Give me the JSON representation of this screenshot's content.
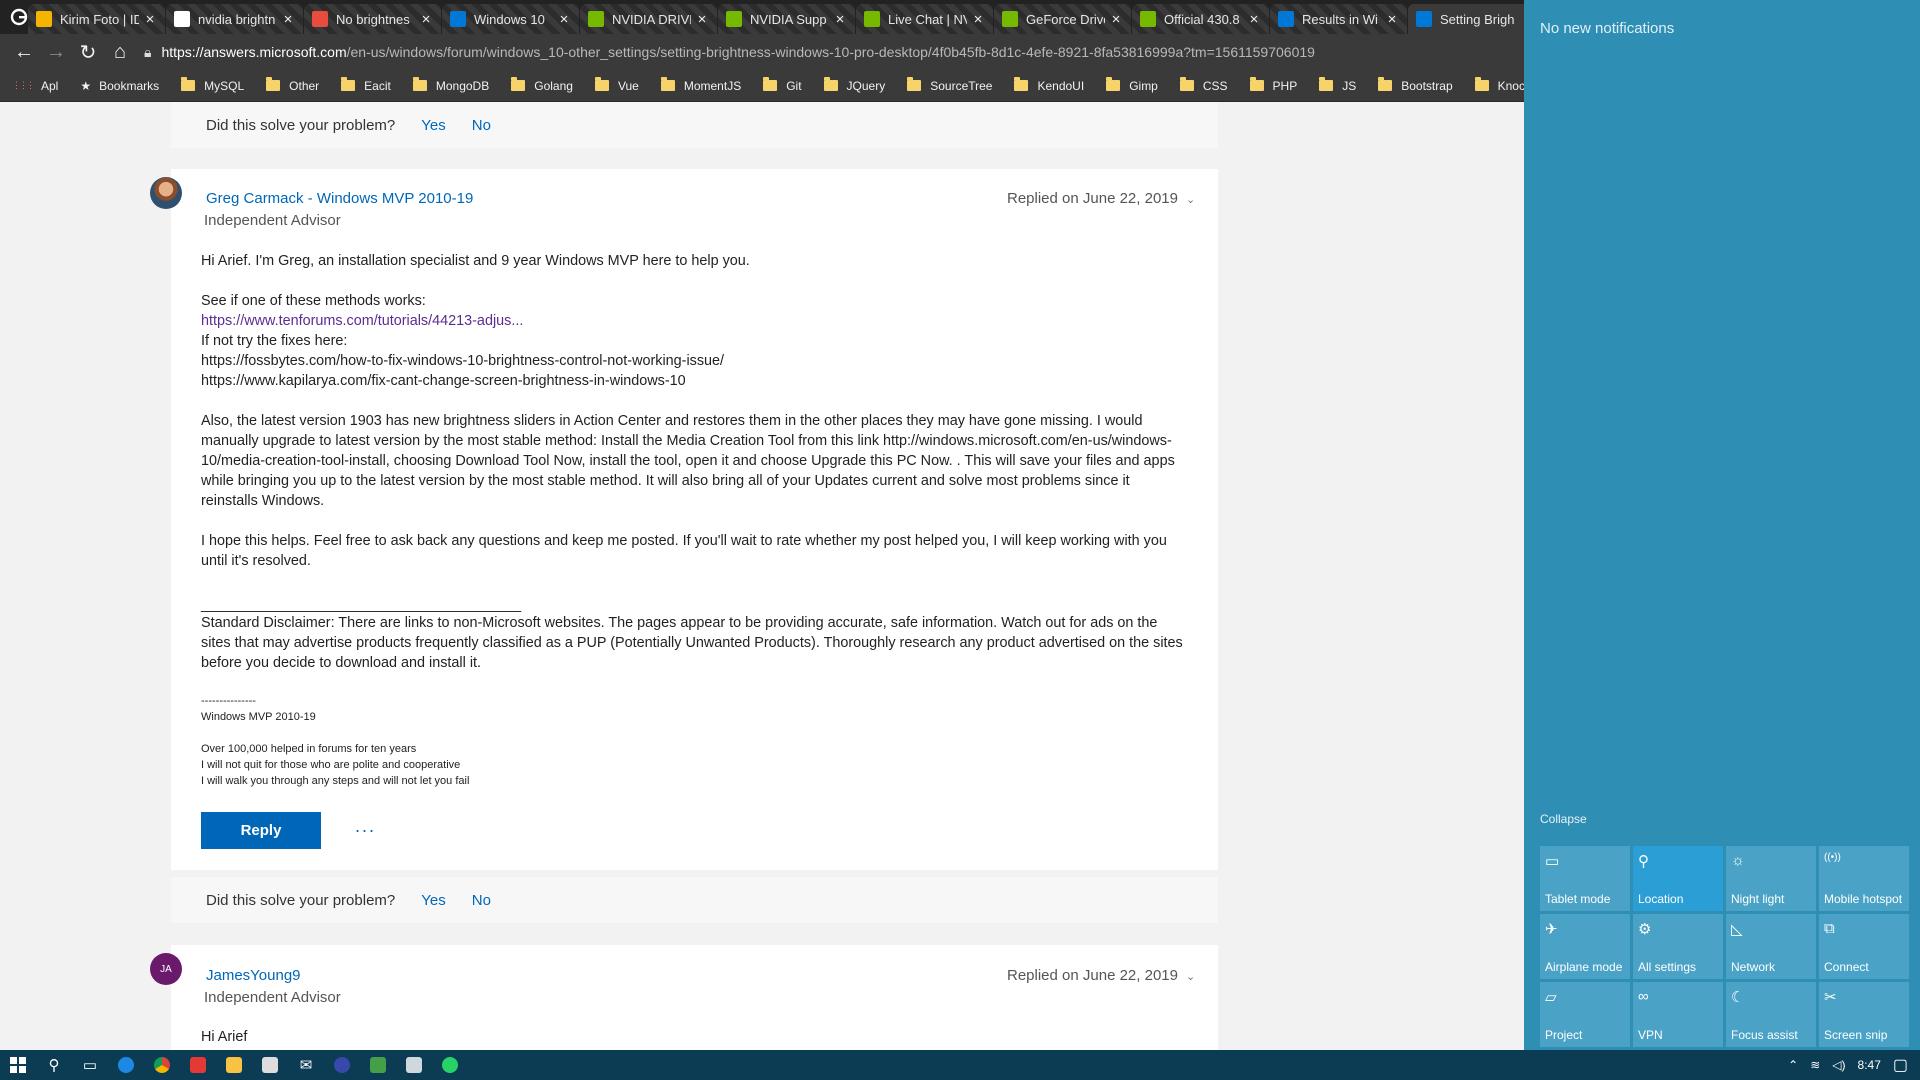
{
  "browser": {
    "tabs": [
      {
        "title": "",
        "fav_color": "#ffffff",
        "fav": "google-icon"
      },
      {
        "title": "Kirim Foto | ID",
        "fav_color": "#f5b400"
      },
      {
        "title": "nvidia brightn",
        "fav_color": "#ffffff",
        "fav": "google-icon"
      },
      {
        "title": "No brightnes",
        "fav_color": "#e74c3c"
      },
      {
        "title": "Windows 10",
        "fav_color": "#0078d7"
      },
      {
        "title": "NVIDIA DRIVE",
        "fav_color": "#76b900"
      },
      {
        "title": "NVIDIA Supp",
        "fav_color": "#76b900"
      },
      {
        "title": "Live Chat | NV",
        "fav_color": "#76b900"
      },
      {
        "title": "GeForce Drive",
        "fav_color": "#76b900"
      },
      {
        "title": "Official 430.8",
        "fav_color": "#76b900"
      },
      {
        "title": "Results in Wi",
        "fav_color": "#0078d7"
      },
      {
        "title": "Setting Brigh",
        "fav_color": "#0078d7"
      }
    ],
    "url_host": "https://answers.microsoft.com",
    "url_path": "/en-us/windows/forum/windows_10-other_settings/setting-brightness-windows-10-pro-desktop/4f0b45fb-8d1c-4efe-8921-8fa53816999a?tm=1561159706019",
    "bookmarks": [
      "Apl",
      "Bookmarks",
      "MySQL",
      "Other",
      "Eacit",
      "MongoDB",
      "Golang",
      "Vue",
      "MomentJS",
      "Git",
      "JQuery",
      "SourceTree",
      "KendoUI",
      "Gimp",
      "CSS",
      "PHP",
      "JS",
      "Bootstrap",
      "KnockOutJS"
    ]
  },
  "page": {
    "solve_question": "Did this solve your problem?",
    "yes": "Yes",
    "no": "No",
    "post1": {
      "author": "Greg Carmack - Windows MVP 2010-19",
      "role": "Independent Advisor",
      "replied": "Replied on June 22, 2019",
      "greeting": "Hi Arief. I'm Greg, an installation specialist and 9 year Windows MVP here to help you.",
      "see_if": "See if one of these methods works:",
      "link1": "https://www.tenforums.com/tutorials/44213-adjus...",
      "if_not": "If not try the fixes here:",
      "url2": "https://fossbytes.com/how-to-fix-windows-10-brightness-control-not-working-issue/",
      "url3": " https://www.kapilarya.com/fix-cant-change-screen-brightness-in-windows-10",
      "para_also": "Also, the latest version 1903 has new brightness sliders in Action Center and restores them in the other places they may have gone missing.  I would manually upgrade to latest version by the most stable method:  Install the Media Creation Tool from this link  http://windows.microsoft.com/en-us/windows-10/media-creation-tool-install, choosing Download Tool Now, install the tool, open it and choose Upgrade this PC Now. .   This will save your files and apps while bringing you up to the latest version by the most stable method.  It will also bring all of your Updates current and solve most problems since it reinstalls Windows.",
      "para_hope": "I hope this helps. Feel free to ask back any questions and keep me posted. If you'll wait to rate whether my post helped you, I will keep working with you until it's resolved.",
      "rule": "________________________________________",
      "disclaimer": "Standard Disclaimer:   There are links to non-Microsoft websites. The pages appear to be providing accurate, safe information. Watch out for ads on the sites that may advertise products frequently classified as a PUP (Potentially Unwanted Products). Thoroughly research any product advertised on the sites before you decide to download and install it.",
      "sig_dashes": "---------------",
      "sig_title": "Windows MVP 2010-19",
      "sig_line1": "Over 100,000 helped in forums for ten years",
      "sig_line2": "I will not quit for those who are polite and cooperative",
      "sig_line3": "I will walk you through any steps and will not let you fail",
      "reply": "Reply",
      "more": "..."
    },
    "post2": {
      "initials": "JA",
      "author": "JamesYoung9",
      "role": "Independent Advisor",
      "replied": "Replied on June 22, 2019",
      "greeting": "Hi Arief"
    }
  },
  "action_center": {
    "notifications": "No new notifications",
    "collapse": "Collapse",
    "tiles": [
      {
        "label": "Tablet mode",
        "icon": "tablet-icon",
        "on": false
      },
      {
        "label": "Location",
        "icon": "location-icon",
        "on": true
      },
      {
        "label": "Night light",
        "icon": "sun-icon",
        "on": false
      },
      {
        "label": "Mobile hotspot",
        "icon": "hotspot-icon",
        "on": false
      },
      {
        "label": "Airplane mode",
        "icon": "airplane-icon",
        "on": false
      },
      {
        "label": "All settings",
        "icon": "gear-icon",
        "on": false
      },
      {
        "label": "Network",
        "icon": "network-icon",
        "on": false
      },
      {
        "label": "Connect",
        "icon": "connect-icon",
        "on": false
      },
      {
        "label": "Project",
        "icon": "project-icon",
        "on": false
      },
      {
        "label": "VPN",
        "icon": "vpn-icon",
        "on": false
      },
      {
        "label": "Focus assist",
        "icon": "moon-icon",
        "on": false
      },
      {
        "label": "Screen snip",
        "icon": "snip-icon",
        "on": false
      }
    ]
  },
  "taskbar": {
    "time": "8:47"
  }
}
